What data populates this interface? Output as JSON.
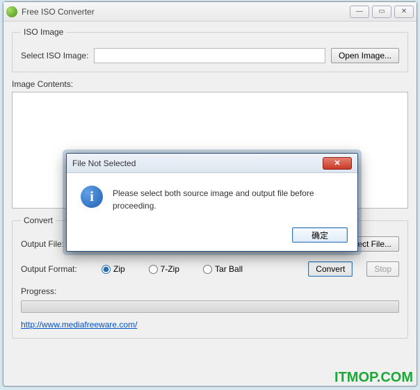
{
  "window": {
    "title": "Free ISO Converter",
    "min_glyph": "—",
    "max_glyph": "▭",
    "close_glyph": "✕"
  },
  "iso": {
    "legend": "ISO Image",
    "select_label": "Select ISO Image:",
    "value": "",
    "open_btn": "Open Image..."
  },
  "contents": {
    "label": "Image Contents:"
  },
  "convert": {
    "legend": "Convert",
    "output_file_label": "Output File:",
    "output_file_value": "",
    "select_file_btn": "Select File...",
    "output_format_label": "Output Format:",
    "formats": [
      "Zip",
      "7-Zip",
      "Tar Ball"
    ],
    "selected_format": "Zip",
    "convert_btn": "Convert",
    "stop_btn": "Stop",
    "progress_label": "Progress:"
  },
  "link": "http://www.mediafreeware.com/",
  "watermark": "ITMOP.COM",
  "modal": {
    "title": "File Not Selected",
    "message": "Please select both source image and output file before proceeding.",
    "ok": "确定",
    "info_glyph": "i",
    "close_glyph": "✕"
  }
}
